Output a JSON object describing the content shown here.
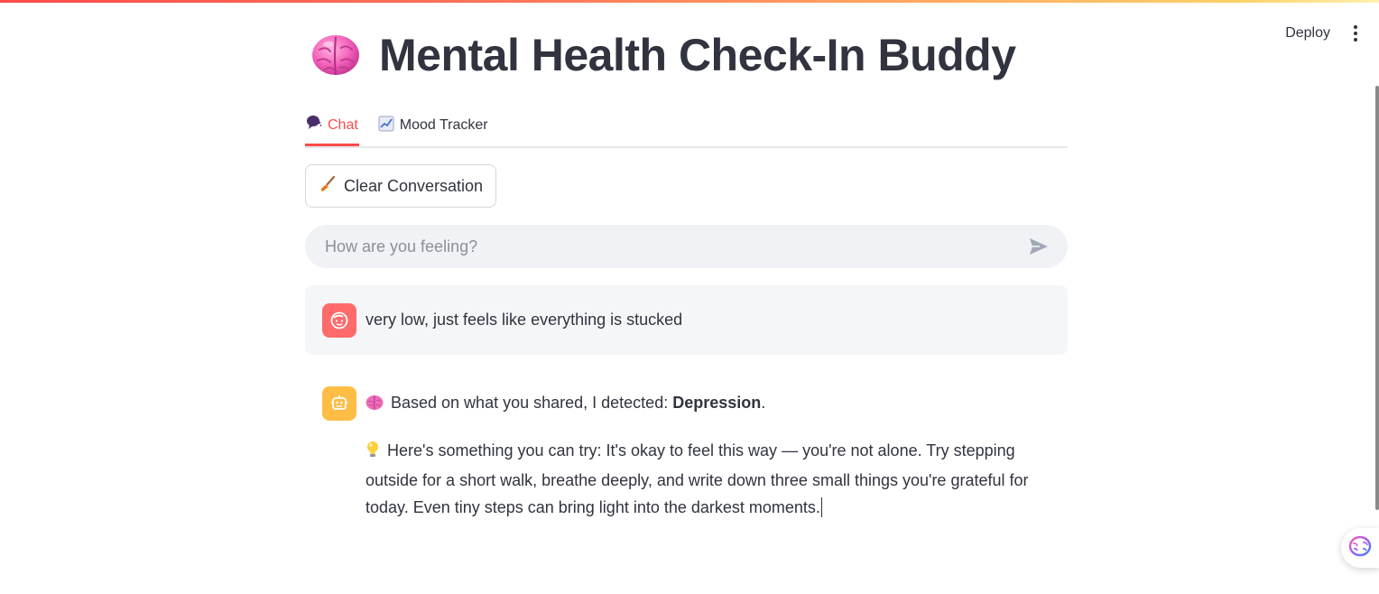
{
  "app": {
    "title": "Mental Health Check-In Buddy",
    "title_icon": "brain-icon"
  },
  "header": {
    "deploy_label": "Deploy",
    "menu_icon": "kebab-menu-icon"
  },
  "tabs": [
    {
      "label": "Chat",
      "icon": "speech-bubble-icon",
      "active": true
    },
    {
      "label": "Mood Tracker",
      "icon": "chart-increasing-icon",
      "active": false
    }
  ],
  "clear_button": {
    "label": "Clear Conversation",
    "icon": "broom-icon"
  },
  "chat_input": {
    "placeholder": "How are you feeling?",
    "value": "",
    "send_icon": "send-icon"
  },
  "messages": {
    "user": {
      "avatar_icon": "user-face-icon",
      "text": "very low, just feels like everything is stucked"
    },
    "assistant": {
      "avatar_icon": "robot-icon",
      "detected_prefix": "Based on what you shared, I detected: ",
      "detected_label": "Depression",
      "detected_suffix": ".",
      "suggestion": "Here's something you can try: It's okay to feel this way — you're not alone. Try stepping outside for a short walk, breathe deeply, and write down three small things you're grateful for today. Even tiny steps can bring light into the darkest moments."
    }
  },
  "colors": {
    "accent": "#ff4b4b",
    "user_avatar": "#ff6b6b",
    "bot_avatar": "#ffbd45",
    "input_bg": "#f0f2f6",
    "text": "#31333f"
  }
}
